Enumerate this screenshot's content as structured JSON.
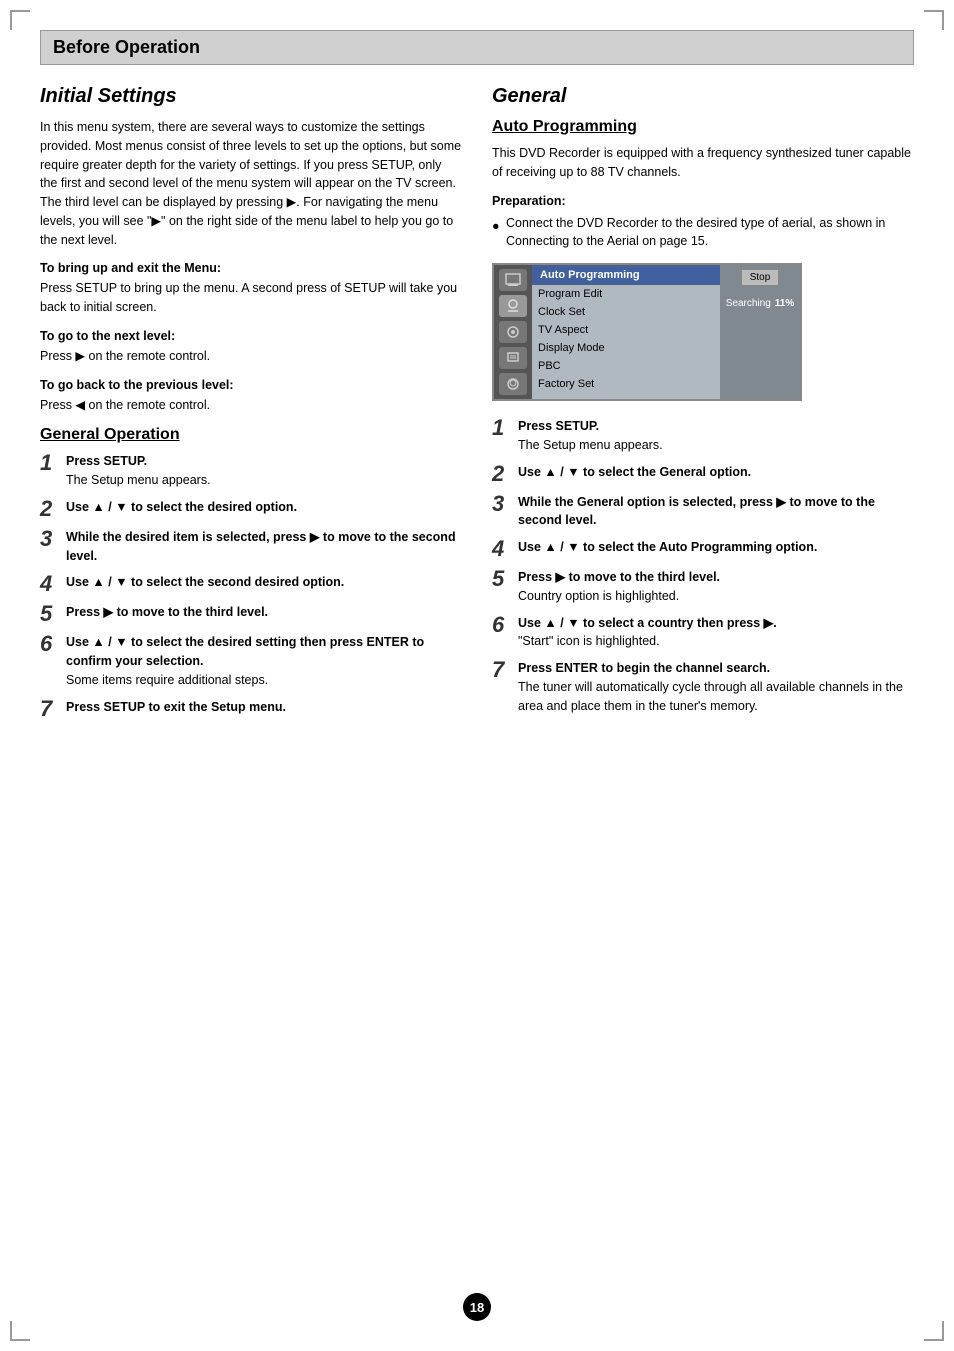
{
  "page": {
    "number": "18"
  },
  "header": {
    "title": "Before Operation"
  },
  "left": {
    "section_title": "Initial Settings",
    "intro_text": "In this menu system, there are several ways to customize the settings provided. Most menus consist of three levels to set up the options, but some require greater depth for the variety of settings. If you press SETUP, only the first and second level of the menu system will appear on the TV screen. The third level can be displayed by pressing ▶. For navigating the menu levels, you will see \"▶\" on the right side of the menu label to help you go to the next level.",
    "menu_label": "To bring up and exit the Menu:",
    "menu_text": "Press SETUP to bring up the menu. A second press of SETUP will take you back to initial screen.",
    "next_level_label": "To go to the next level:",
    "next_level_text": "Press ▶ on the remote control.",
    "prev_level_label": "To go back to the previous level:",
    "prev_level_text": "Press ◀ on the remote control.",
    "general_operation_title": "General Operation",
    "steps": [
      {
        "number": "1",
        "bold": "Press SETUP.",
        "note": "The Setup menu appears."
      },
      {
        "number": "2",
        "bold": "Use ▲ / ▼ to select the desired option.",
        "note": ""
      },
      {
        "number": "3",
        "bold": "While the desired item is selected, press ▶ to move to the second level.",
        "note": ""
      },
      {
        "number": "4",
        "bold": "Use ▲ / ▼ to select the second desired option.",
        "note": ""
      },
      {
        "number": "5",
        "bold": "Press ▶ to move to the third level.",
        "note": ""
      },
      {
        "number": "6",
        "bold": "Use ▲ / ▼ to select the desired setting then press ENTER to confirm your selection.",
        "note": "Some items require additional steps."
      },
      {
        "number": "7",
        "bold": "Press SETUP to exit the Setup menu.",
        "note": ""
      }
    ]
  },
  "right": {
    "section_title": "General",
    "subsection_title": "Auto Programming",
    "intro_text": "This DVD Recorder is equipped with a frequency synthesized tuner capable of receiving up to 88 TV channels.",
    "preparation_label": "Preparation:",
    "preparation_bullet": "Connect the DVD Recorder to the desired type of aerial, as shown in Connecting to the Aerial on page 15.",
    "menu": {
      "highlighted_item": "Auto Programming",
      "items": [
        "Program Edit",
        "Clock Set",
        "TV Aspect",
        "Display Mode",
        "PBC",
        "Factory Set"
      ],
      "stop_button": "Stop",
      "searching_label": "Searching",
      "searching_percent": "11%"
    },
    "steps": [
      {
        "number": "1",
        "bold": "Press SETUP.",
        "note": "The Setup menu appears."
      },
      {
        "number": "2",
        "bold": "Use ▲ / ▼ to select the General option.",
        "note": ""
      },
      {
        "number": "3",
        "bold": "While the General option is selected, press ▶ to move to the second level.",
        "note": ""
      },
      {
        "number": "4",
        "bold": "Use ▲ / ▼ to select the Auto Programming option.",
        "note": ""
      },
      {
        "number": "5",
        "bold": "Press ▶ to move to the third level.",
        "note": "Country option is highlighted."
      },
      {
        "number": "6",
        "bold": "Use ▲ / ▼ to select a country then press ▶.",
        "note": "\"Start\" icon is highlighted."
      },
      {
        "number": "7",
        "bold": "Press ENTER to begin the channel search.",
        "note": "The tuner will automatically cycle through all available channels in the area and place them in the tuner's memory."
      }
    ]
  }
}
